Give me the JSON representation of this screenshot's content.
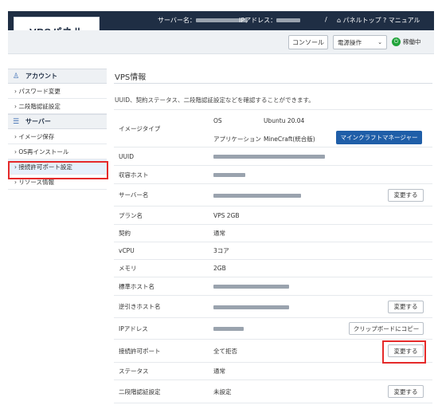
{
  "header": {
    "logo": "VPSパネル",
    "server_name_label": "サーバー名：",
    "ip_label": "IPアドレス：",
    "separator": "/",
    "panel_top": "パネルトップ",
    "manual": "マニュアル",
    "console_button": "コンソール",
    "power_select": "電源操作",
    "status_text": "稼働中"
  },
  "sidebar": {
    "account_head": "アカウント",
    "account_items": [
      "› パスワード変更",
      "› 二段階認証設定"
    ],
    "server_head": "サーバー",
    "server_items": [
      "› イメージ保存",
      "› OS再インストール",
      "› 接続許可ポート設定",
      "› リソース情報"
    ]
  },
  "main": {
    "title": "VPS情報",
    "description": "UUID、契約ステータス、二段階認証設定などを確認することができます。",
    "image_type": {
      "label": "イメージタイプ",
      "os_label": "OS",
      "os_value": "Ubuntu 20.04",
      "app_label": "アプリケーション",
      "app_value": "MineCraft(統合版)",
      "app_button": "マインクラフトマネージャー"
    },
    "rows": [
      {
        "label": "UUID",
        "value": ""
      },
      {
        "label": "収容ホスト",
        "value": ""
      },
      {
        "label": "サーバー名",
        "value": "",
        "button": "変更する"
      },
      {
        "label": "プラン名",
        "value": "VPS 2GB"
      },
      {
        "label": "契約",
        "value": "通常"
      },
      {
        "label": "vCPU",
        "value": "3コア"
      },
      {
        "label": "メモリ",
        "value": "2GB"
      },
      {
        "label": "標準ホスト名",
        "value": ""
      },
      {
        "label": "逆引きホスト名",
        "value": "",
        "button": "変更する"
      },
      {
        "label": "IPアドレス",
        "value": "",
        "button": "クリップボードにコピー"
      },
      {
        "label": "接続許可ポート",
        "value": "全て拒否",
        "button": "変更する"
      },
      {
        "label": "ステータス",
        "value": "通常"
      },
      {
        "label": "二段階認証設定",
        "value": "未設定",
        "button": "変更する"
      }
    ]
  },
  "colors": {
    "header_bg": "#1f2e44",
    "accent_blue": "#1f5ea8",
    "highlight_red": "#e52a2a",
    "status_green": "#21a33a"
  }
}
